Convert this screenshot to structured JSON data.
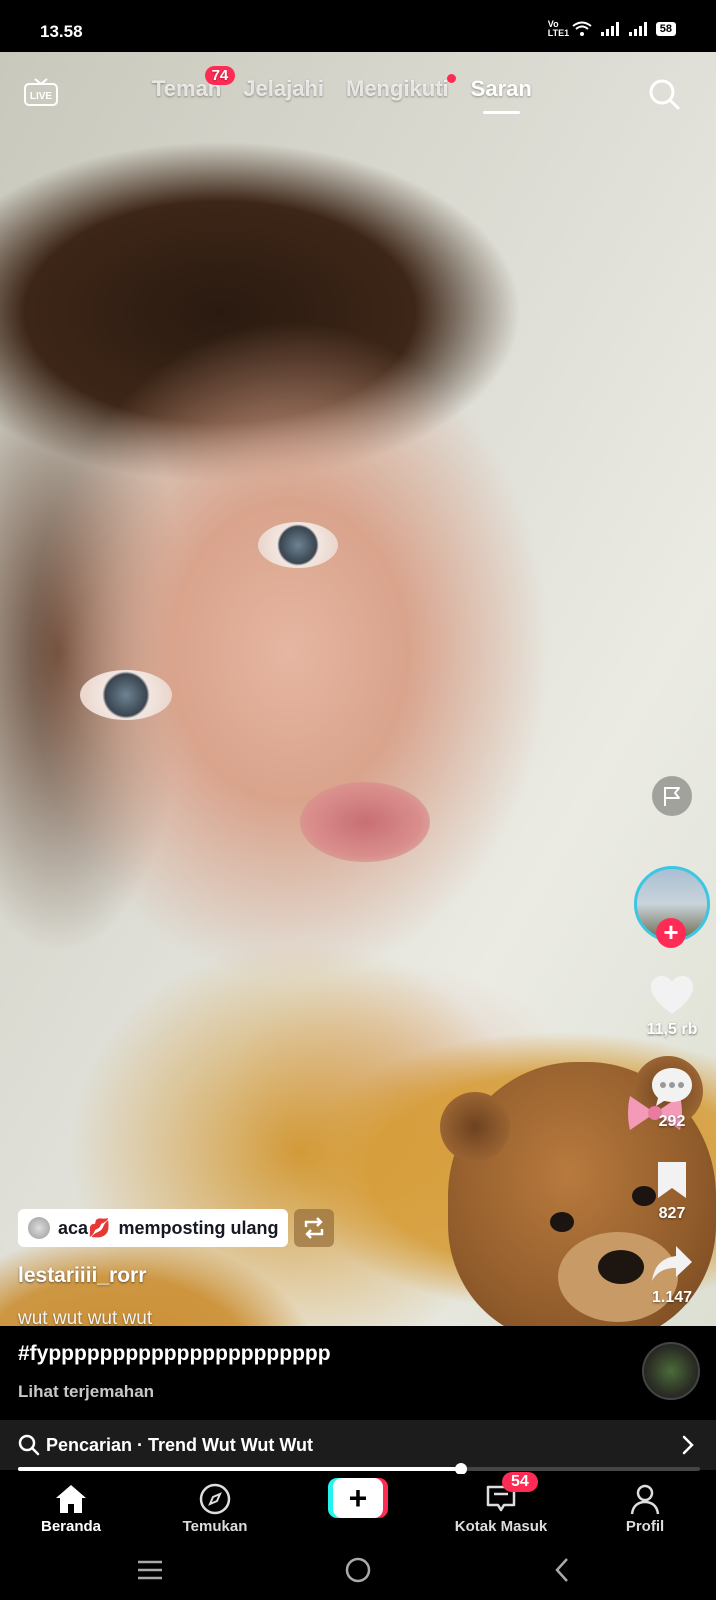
{
  "status_bar": {
    "time": "13.58",
    "network_label": "Vo LTE1",
    "battery": "58"
  },
  "top_nav": {
    "live_label": "LIVE",
    "tabs": [
      {
        "label": "Teman",
        "badge": "74"
      },
      {
        "label": "Jelajahi"
      },
      {
        "label": "Mengikuti",
        "dot": true
      },
      {
        "label": "Saran",
        "active": true
      }
    ]
  },
  "actions": {
    "likes": "11,5 rb",
    "comments": "292",
    "bookmarks": "827",
    "shares": "1.147"
  },
  "post": {
    "repost_user": "aca💋",
    "repost_text": "memposting ulang",
    "username": "lestariiii_rorr",
    "caption_line1": "wut wut wut wut",
    "caption_line2": "#fypppppppppppppppppppppp",
    "translate": "Lihat terjemahan"
  },
  "search_bar": {
    "text": "Pencarian · Trend Wut Wut Wut"
  },
  "progress": 0.65,
  "bottom_nav": {
    "home": "Beranda",
    "discover": "Temukan",
    "inbox": "Kotak Masuk",
    "inbox_badge": "54",
    "profile": "Profil"
  },
  "colors": {
    "accent": "#fe2c55",
    "cyan": "#25f4ee",
    "avatar_ring": "#3bc6e2"
  }
}
